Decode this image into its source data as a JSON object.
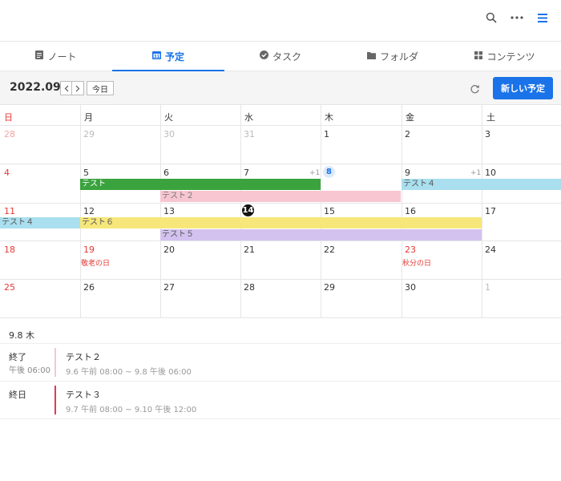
{
  "topbar": {
    "icons": [
      "search-icon",
      "more-icon",
      "menu-icon"
    ]
  },
  "tabs": [
    {
      "label": "ノート",
      "icon": "note-icon"
    },
    {
      "label": "予定",
      "icon": "calendar-icon",
      "active": true
    },
    {
      "label": "タスク",
      "icon": "check-circle-icon"
    },
    {
      "label": "フォルダ",
      "icon": "folder-icon"
    },
    {
      "label": "コンテンツ",
      "icon": "grid-icon"
    }
  ],
  "calendar": {
    "month": "2022.09",
    "today_label": "今日",
    "new_label": "新しい予定",
    "weekdays": [
      "日",
      "月",
      "火",
      "水",
      "木",
      "金",
      "土"
    ],
    "weeks": [
      [
        "28",
        "29",
        "30",
        "31",
        "1",
        "2",
        "3"
      ],
      [
        "4",
        "5",
        "6",
        "7",
        "8",
        "9",
        "10"
      ],
      [
        "11",
        "12",
        "13",
        "14",
        "15",
        "16",
        "17"
      ],
      [
        "18",
        "19",
        "20",
        "21",
        "22",
        "23",
        "24"
      ],
      [
        "25",
        "26",
        "27",
        "28",
        "29",
        "30",
        "1"
      ]
    ],
    "more_7": "+1",
    "more_9": "+1",
    "holiday_19": "敬老の日",
    "holiday_23": "秋分の日",
    "events": {
      "test": "テスト",
      "test2": "テスト２",
      "test4_w1": "テスト４",
      "test4_w2": "テスト４",
      "test6": "テスト６",
      "test5": "テスト５"
    },
    "colors": {
      "test": "#3aa33e",
      "test2": "#f7c6d1",
      "test4": "#a9dfee",
      "test6": "#f7e77a",
      "test5": "#d3c2ef",
      "accent": "#1a73e8"
    }
  },
  "agenda": {
    "date": "9.8 木",
    "items": [
      {
        "label": "終了",
        "time": "午後 06:00",
        "title": "テスト２",
        "range": "9.6 午前 08:00 ~ 9.8 午後 06:00",
        "color": "#f7c6d1"
      },
      {
        "label": "終日",
        "time": "",
        "title": "テスト３",
        "range": "9.7 午前 08:00 ~ 9.10 午後 12:00",
        "color": "#e53950"
      }
    ]
  }
}
